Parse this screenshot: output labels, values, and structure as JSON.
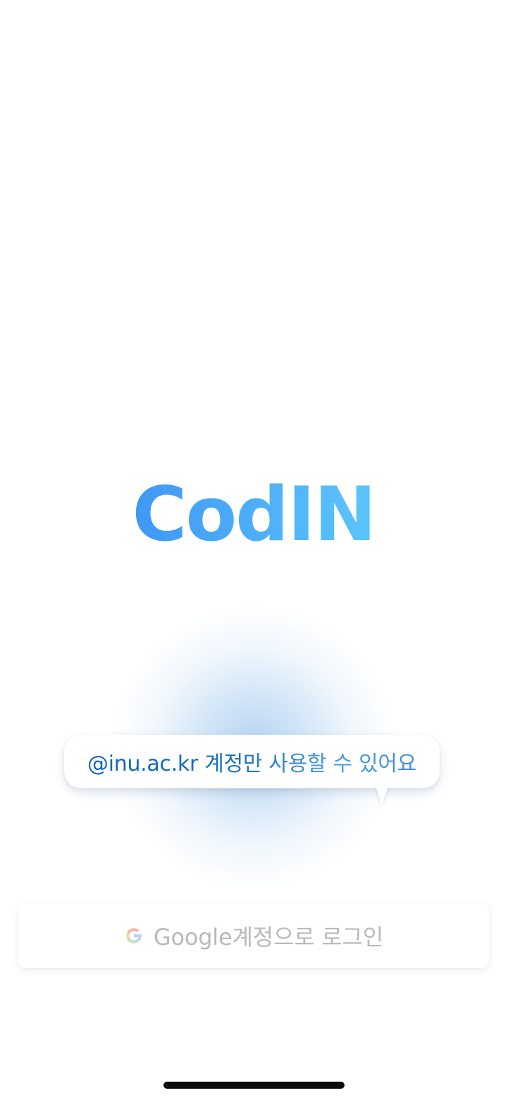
{
  "app": {
    "logo_text": "CodIN"
  },
  "notice": {
    "text": "@inu.ac.kr 계정만 사용할 수 있어요"
  },
  "login": {
    "label": "Google계정으로 로그인",
    "icon": "google-icon"
  },
  "colors": {
    "logo_gradient_start": "#3f97f5",
    "logo_gradient_end": "#5cc6fb",
    "notice_text": "#1a6fc3",
    "login_text": "#b9b9b9"
  }
}
